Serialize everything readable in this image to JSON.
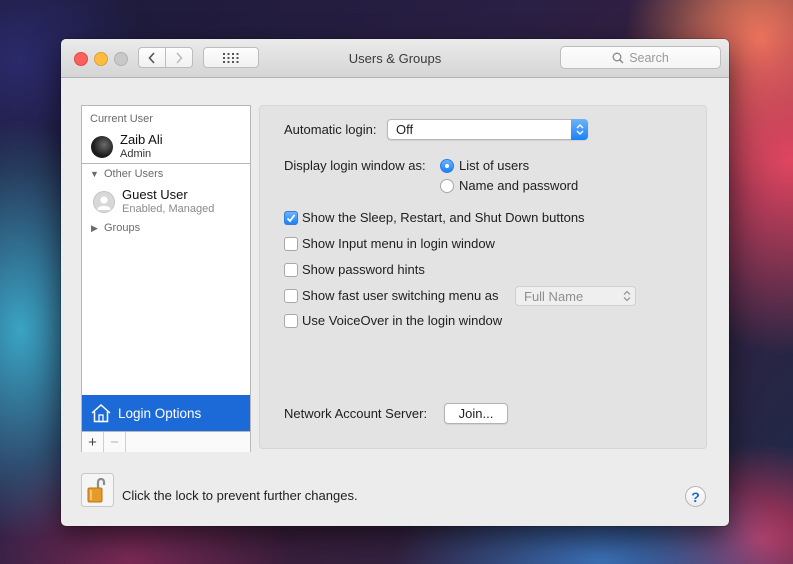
{
  "window": {
    "title": "Users & Groups"
  },
  "toolbar": {
    "search_placeholder": "Search"
  },
  "sidebar": {
    "current_user_header": "Current User",
    "current_user": {
      "name": "Zaib Ali",
      "role": "Admin"
    },
    "other_users_header": "Other Users",
    "guest_user": {
      "name": "Guest User",
      "status": "Enabled, Managed"
    },
    "groups_label": "Groups",
    "login_options_label": "Login Options",
    "add_label": "+",
    "remove_label": "−"
  },
  "panel": {
    "automatic_login_label": "Automatic login:",
    "automatic_login_value": "Off",
    "display_login_label": "Display login window as:",
    "display_options": [
      {
        "label": "List of users",
        "selected": true
      },
      {
        "label": "Name and password",
        "selected": false
      }
    ],
    "checkboxes": [
      {
        "label": "Show the Sleep, Restart, and Shut Down buttons",
        "checked": true
      },
      {
        "label": "Show Input menu in login window",
        "checked": false
      },
      {
        "label": "Show password hints",
        "checked": false
      },
      {
        "label": "Show fast user switching menu as",
        "checked": false
      },
      {
        "label": "Use VoiceOver in the login window",
        "checked": false
      }
    ],
    "fast_switch_value": "Full Name",
    "network_server_label": "Network Account Server:",
    "join_button_label": "Join..."
  },
  "footer": {
    "lock_text": "Click the lock to prevent further changes.",
    "help_label": "?"
  },
  "colors": {
    "accent": "#1c6ad8",
    "close": "#fc605c",
    "minimize": "#fdbc40",
    "zoom_disabled": "#c8c8c8"
  }
}
